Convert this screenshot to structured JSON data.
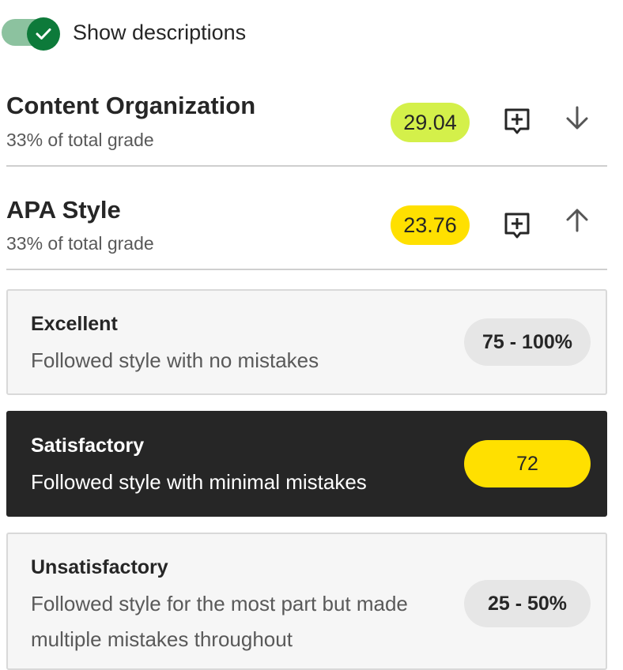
{
  "toggle": {
    "label": "Show descriptions",
    "checked": true
  },
  "criteria": [
    {
      "title": "Content Organization",
      "subtitle": "33% of total grade",
      "score": "29.04",
      "score_color": "#d4f04a",
      "add_comment_icon": "add-comment-icon",
      "expand_icon": "arrow-down-icon",
      "expanded": false
    },
    {
      "title": "APA Style",
      "subtitle": "33% of total grade",
      "score": "23.76",
      "score_color": "#ffe000",
      "add_comment_icon": "add-comment-icon",
      "expand_icon": "arrow-up-icon",
      "expanded": true
    }
  ],
  "levels": [
    {
      "title": "Excellent",
      "description": "Followed style with no mistakes",
      "range": "75 - 100%",
      "selected": false
    },
    {
      "title": "Satisfactory",
      "description": "Followed style with minimal mistakes",
      "range": "72",
      "selected": true
    },
    {
      "title": "Unsatisfactory",
      "description_line1": "Followed style for the most part but made",
      "description_line2": "multiple mistakes throughout",
      "range": "25 - 50%",
      "selected": false
    }
  ],
  "colors": {
    "toggle_on": "#0d7a3a",
    "toggle_track": "#8cc29f",
    "selected_bg": "#262626",
    "highlight_yellow": "#ffe000",
    "highlight_lime": "#d4f04a"
  }
}
